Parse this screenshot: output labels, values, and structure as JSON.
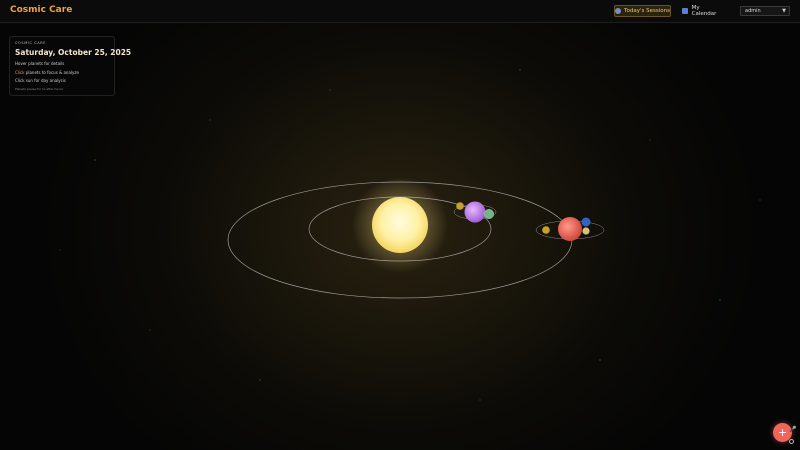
{
  "header": {
    "brand": "Cosmic Care",
    "sessions_label": "Today's Sessions",
    "calendar_label": "My Calendar",
    "user_select_value": "admin",
    "accent_color": "#f0a23c"
  },
  "info_card": {
    "label": "COSMIC CARE",
    "date": "Saturday, October 25, 2025",
    "tip_hover_rest": "planets for details",
    "tip_hover_kw": "Hover",
    "tip_click_kw": "Click",
    "tip_click_rest": "planets to focus & analyze",
    "tip_sun": "Click sun for day analysis",
    "tip_small": "Planets pause for 1s after hover"
  },
  "fab": {
    "label": "+",
    "color": "#f0645a"
  },
  "icons": [
    "planet-icon",
    "calendar-icon",
    "chevron-down-icon",
    "plus-icon",
    "mic-icon"
  ]
}
